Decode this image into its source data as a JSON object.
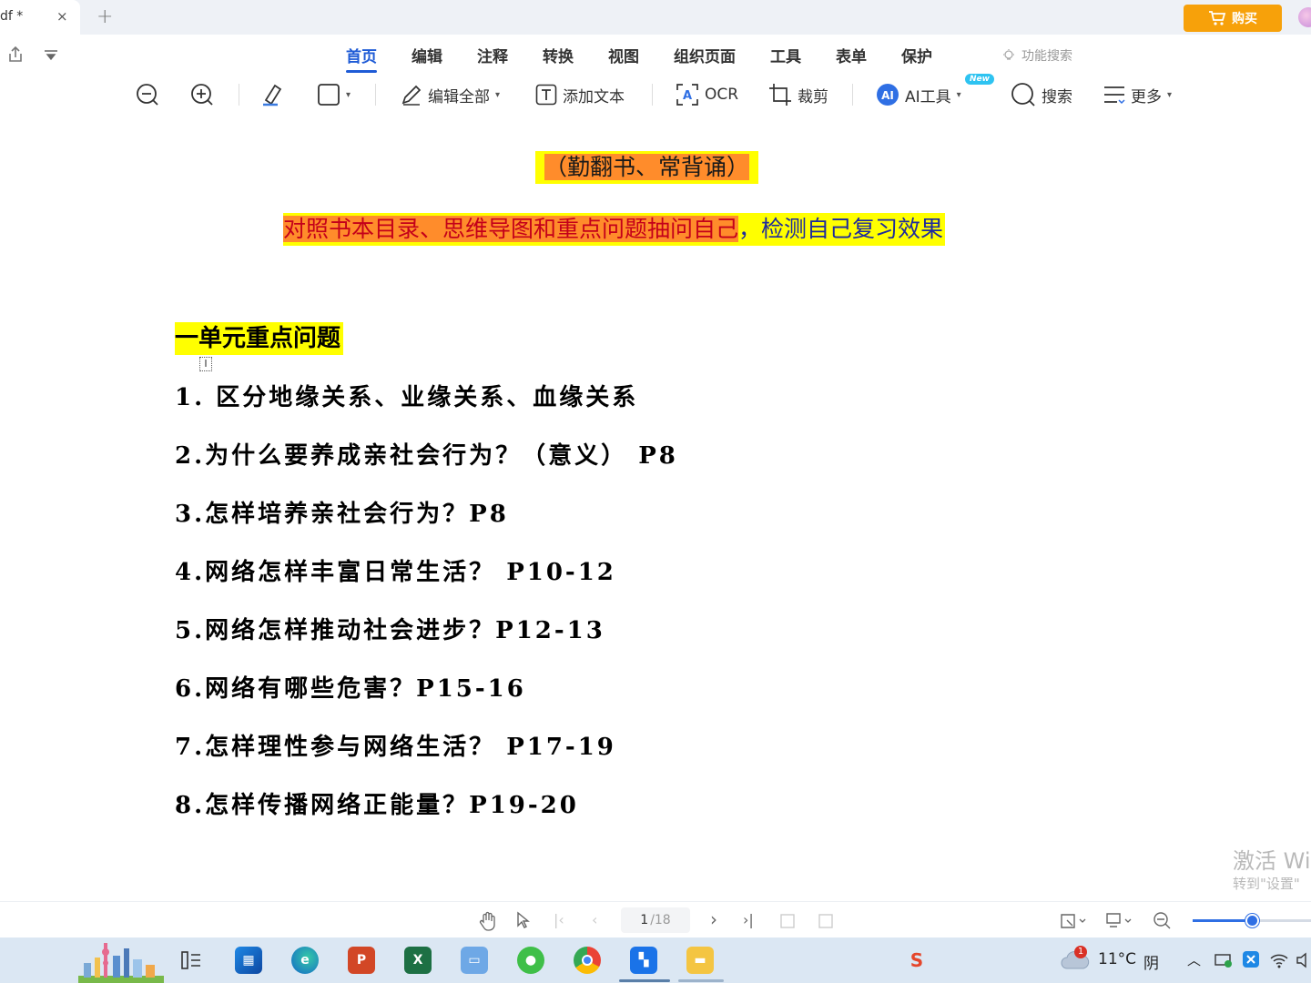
{
  "titlebar": {
    "tab_title": "df *",
    "tab_close": "×",
    "new_tab": "+",
    "buy_label": "购买"
  },
  "menu": {
    "tabs": [
      "首页",
      "编辑",
      "注释",
      "转换",
      "视图",
      "组织页面",
      "工具",
      "表单",
      "保护"
    ],
    "active_tab": "首页",
    "function_search": "功能搜索"
  },
  "toolbar": {
    "edit_all": "编辑全部",
    "add_text": "添加文本",
    "ocr": "OCR",
    "crop": "裁剪",
    "ai_tools": "AI工具",
    "ai_badge": "New",
    "search": "搜索",
    "more": "更多"
  },
  "document": {
    "motto": "（勤翻书、常背诵）",
    "subtitle_highlighted": "对照书本目录、思维导图和重点问题抽问自己",
    "subtitle_rest": "，检测自己复习效果",
    "unit_heading": "一单元重点问题",
    "questions": [
      "1. 区分地缘关系、业缘关系、血缘关系",
      "2.为什么要养成亲社会行为？（意义） P8",
      "3.怎样培养亲社会行为？P8",
      "4.网络怎样丰富日常生活？ P10-12",
      "5.网络怎样推动社会进步？P12-13",
      "6.网络有哪些危害？P15-16",
      "7.怎样理性参与网络生活？ P17-19",
      "8.怎样传播网络正能量？P19-20"
    ],
    "watermark_line1": "激活 Wi",
    "watermark_line2": "转到\"设置\""
  },
  "statusbar": {
    "current_page": "1",
    "total_pages": "/18",
    "zoom_fraction": 0.5
  },
  "taskbar": {
    "weather_temp": "11°C",
    "weather_desc": "阴",
    "notification_count": "1"
  },
  "colors": {
    "accent": "#1e5bd6",
    "highlight_yellow": "#ffff00",
    "highlight_orange": "#ff8c2b",
    "subtitle_blue": "#1d2a9e",
    "buy_orange": "#f7a10a"
  }
}
